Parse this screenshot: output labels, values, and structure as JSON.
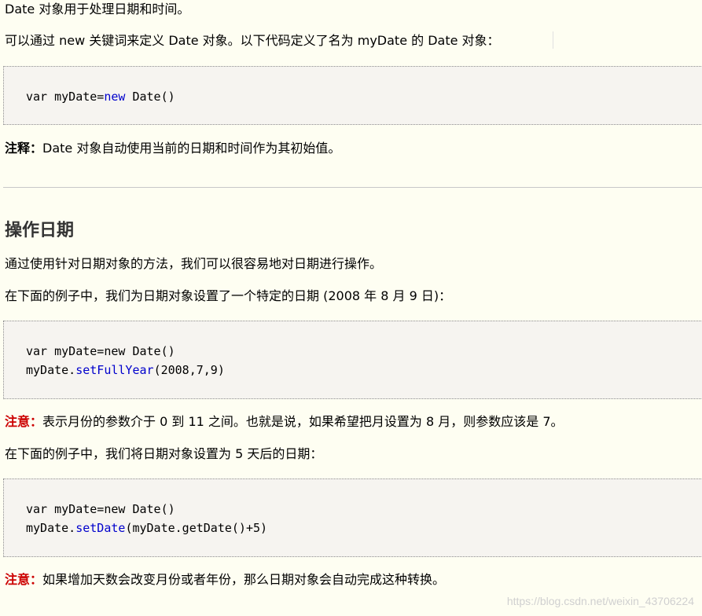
{
  "p1": "Date 对象用于处理日期和时间。",
  "p2": "可以通过 new 关键词来定义 Date 对象。以下代码定义了名为 myDate 的 Date 对象：",
  "code1": {
    "l1_a": "var myDate=",
    "l1_kw": "new",
    "l1_b": " Date()"
  },
  "note1": {
    "label": "注释：",
    "text": "Date 对象自动使用当前的日期和时间作为其初始值。"
  },
  "section_title": "操作日期",
  "p3": "通过使用针对日期对象的方法，我们可以很容易地对日期进行操作。",
  "p4": "在下面的例子中，我们为日期对象设置了一个特定的日期 (2008 年 8 月 9 日)：",
  "code2": {
    "l1": "var myDate=new Date()",
    "l2_a": "myDate.",
    "l2_fn": "setFullYear",
    "l2_b": "(2008,7,9)"
  },
  "note2": {
    "label": "注意：",
    "text": "表示月份的参数介于 0 到 11 之间。也就是说，如果希望把月设置为 8 月，则参数应该是 7。"
  },
  "p5": "在下面的例子中，我们将日期对象设置为 5 天后的日期：",
  "code3": {
    "l1": "var myDate=new Date()",
    "l2_a": "myDate.",
    "l2_fn": "setDate",
    "l2_b": "(myDate.getDate()+5)"
  },
  "note3": {
    "label": "注意：",
    "text": "如果增加天数会改变月份或者年份，那么日期对象会自动完成这种转换。"
  },
  "watermark": "https://blog.csdn.net/weixin_43706224"
}
